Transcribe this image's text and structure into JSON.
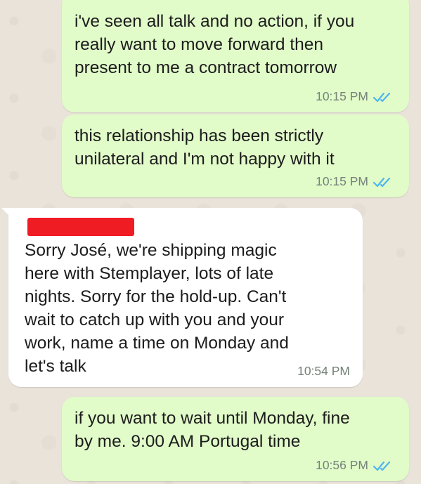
{
  "messages": [
    {
      "direction": "outgoing",
      "text": "i've seen all talk and no action, if you\nreally want to move forward then\npresent to me a contract tomorrow",
      "time": "10:15 PM",
      "status": "read"
    },
    {
      "direction": "outgoing",
      "text": "this relationship has been strictly\nunilateral and I'm not happy with it",
      "time": "10:15 PM",
      "status": "read"
    },
    {
      "direction": "incoming",
      "sender_redacted": true,
      "text": "Sorry José, we're shipping magic\nhere with Stemplayer, lots of late\nnights. Sorry for the hold-up. Can't\nwait to catch up with you and your\nwork, name a time on Monday and\nlet's talk",
      "time": "10:54 PM"
    },
    {
      "direction": "outgoing",
      "text": "if you want to wait until Monday, fine\nby me. 9:00 AM Portugal time",
      "time": "10:56 PM",
      "status": "read"
    }
  ],
  "colors": {
    "outgoing_bubble": "#e1fbc9",
    "incoming_bubble": "#ffffff",
    "read_ticks": "#4fb6ec",
    "redaction": "#f01c24",
    "background": "#e9e3d9"
  },
  "icons": {
    "read_status": "double-check-icon"
  }
}
